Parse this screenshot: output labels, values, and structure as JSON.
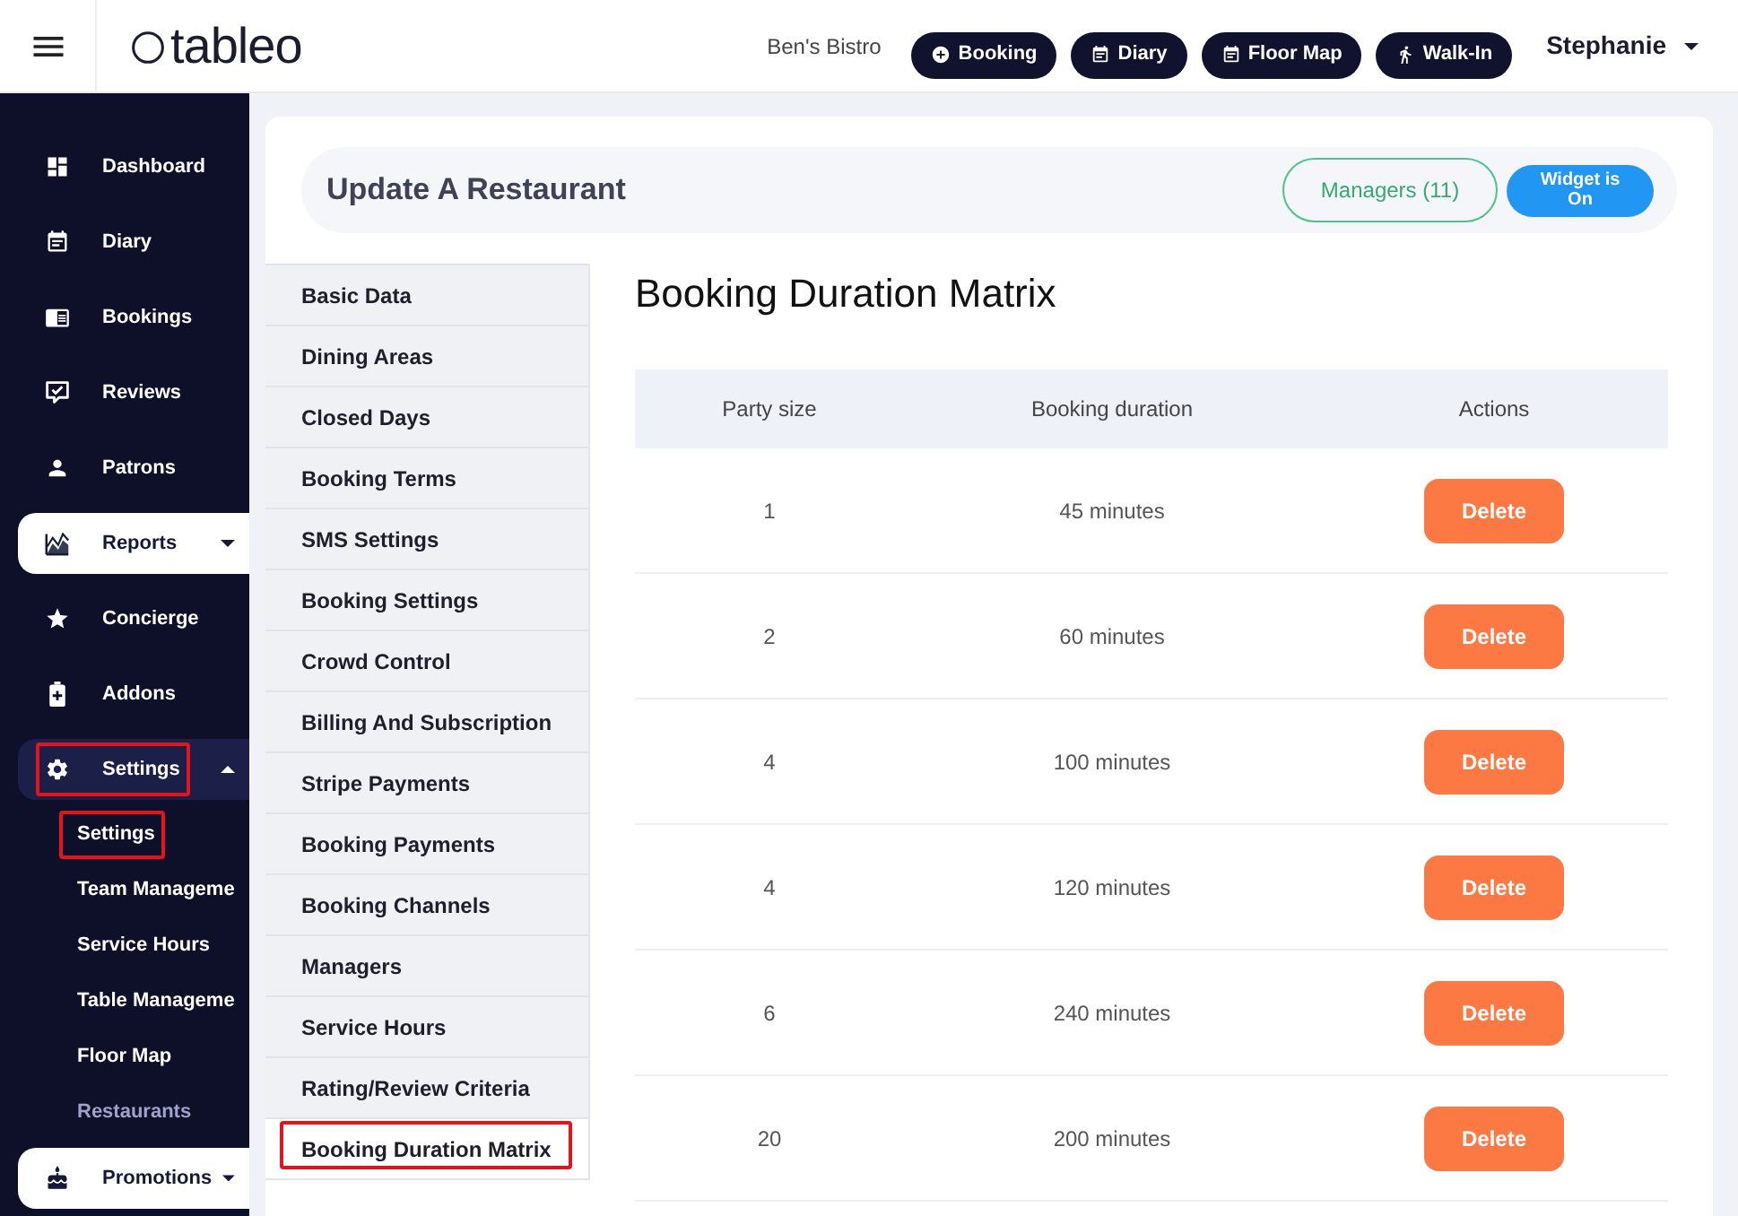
{
  "top_bar": {
    "brand": "tableo",
    "restaurant": "Ben's Bistro",
    "actions": [
      {
        "label": "Booking"
      },
      {
        "label": "Diary"
      },
      {
        "label": "Floor Map"
      },
      {
        "label": "Walk-In"
      }
    ],
    "user": "Stephanie"
  },
  "sidebar": {
    "items": [
      {
        "kind": "link",
        "label": "Dashboard",
        "active": false,
        "highlighted": false
      },
      {
        "kind": "link",
        "label": "Diary",
        "active": false,
        "highlighted": false
      },
      {
        "kind": "link",
        "label": "Bookings",
        "active": false,
        "highlighted": false
      },
      {
        "kind": "link",
        "label": "Reviews",
        "active": false,
        "highlighted": false
      },
      {
        "kind": "link",
        "label": "Patrons",
        "active": false,
        "highlighted": false
      },
      {
        "kind": "menu",
        "label": "Reports",
        "active": true,
        "expanded": false,
        "highlighted": false
      },
      {
        "kind": "link",
        "label": "Concierge",
        "active": false,
        "highlighted": false
      },
      {
        "kind": "link",
        "label": "Addons",
        "active": false,
        "highlighted": false
      },
      {
        "kind": "menu",
        "label": "Settings",
        "active": false,
        "expanded": true,
        "highlighted": true,
        "children": [
          {
            "label": "Settings",
            "dimmed": false,
            "highlighted": true
          },
          {
            "label": "Team Manageme",
            "dimmed": false,
            "highlighted": false
          },
          {
            "label": "Service Hours",
            "dimmed": false,
            "highlighted": false
          },
          {
            "label": "Table Manageme",
            "dimmed": false,
            "highlighted": false
          },
          {
            "label": "Floor Map",
            "dimmed": false,
            "highlighted": false
          },
          {
            "label": "Restaurants",
            "dimmed": true,
            "highlighted": false
          }
        ]
      },
      {
        "kind": "menu",
        "label": "Promotions",
        "active": true,
        "expanded": false,
        "highlighted": false
      }
    ]
  },
  "page_header": {
    "title": "Update A Restaurant",
    "managers_button": "Managers (11)",
    "widget_button": "Widget is On"
  },
  "tabs": [
    {
      "label": "Basic Data",
      "selected": false,
      "highlighted": false
    },
    {
      "label": "Dining Areas",
      "selected": false,
      "highlighted": false
    },
    {
      "label": "Closed Days",
      "selected": false,
      "highlighted": false
    },
    {
      "label": "Booking Terms",
      "selected": false,
      "highlighted": false
    },
    {
      "label": "SMS Settings",
      "selected": false,
      "highlighted": false
    },
    {
      "label": "Booking Settings",
      "selected": false,
      "highlighted": false
    },
    {
      "label": "Crowd Control",
      "selected": false,
      "highlighted": false
    },
    {
      "label": "Billing And Subscription",
      "selected": false,
      "highlighted": false
    },
    {
      "label": "Stripe Payments",
      "selected": false,
      "highlighted": false
    },
    {
      "label": "Booking Payments",
      "selected": false,
      "highlighted": false
    },
    {
      "label": "Booking Channels",
      "selected": false,
      "highlighted": false
    },
    {
      "label": "Managers",
      "selected": false,
      "highlighted": false
    },
    {
      "label": "Service Hours",
      "selected": false,
      "highlighted": false
    },
    {
      "label": "Rating/Review Criteria",
      "selected": false,
      "highlighted": false
    },
    {
      "label": "Booking Duration Matrix",
      "selected": true,
      "highlighted": true
    }
  ],
  "content": {
    "title": "Booking Duration Matrix",
    "table": {
      "columns": [
        "Party size",
        "Booking duration",
        "Actions"
      ],
      "rows": [
        {
          "party_size": "1",
          "booking_duration": "45 minutes",
          "action": "Delete"
        },
        {
          "party_size": "2",
          "booking_duration": "60 minutes",
          "action": "Delete"
        },
        {
          "party_size": "4",
          "booking_duration": "100 minutes",
          "action": "Delete"
        },
        {
          "party_size": "4",
          "booking_duration": "120 minutes",
          "action": "Delete"
        },
        {
          "party_size": "6",
          "booking_duration": "240 minutes",
          "action": "Delete"
        },
        {
          "party_size": "20",
          "booking_duration": "200 minutes",
          "action": "Delete"
        }
      ]
    }
  }
}
